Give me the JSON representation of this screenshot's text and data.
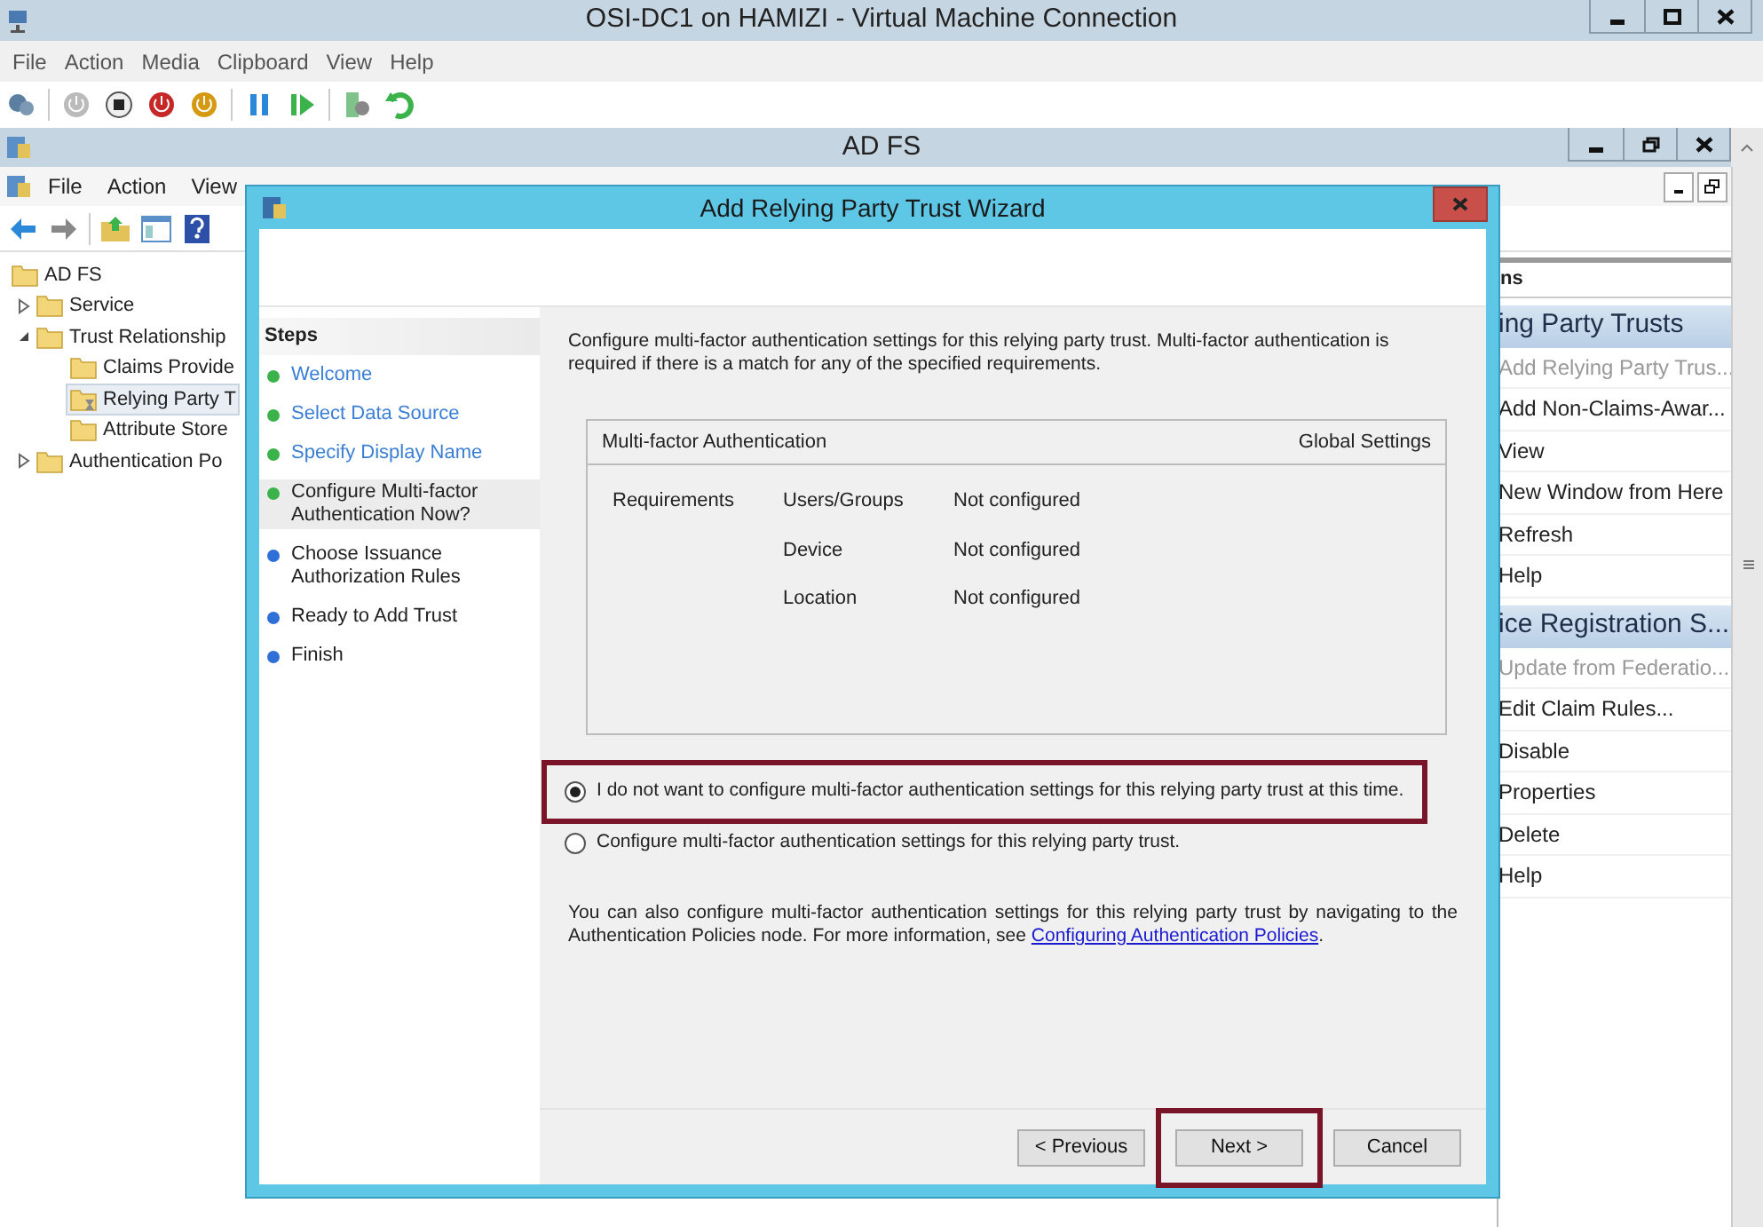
{
  "vm_window": {
    "title": "OSI-DC1 on HAMIZI - Virtual Machine Connection",
    "menu": [
      "File",
      "Action",
      "Media",
      "Clipboard",
      "View",
      "Help"
    ]
  },
  "adfs_window": {
    "title": "AD FS",
    "menu": [
      "File",
      "Action",
      "View"
    ],
    "tree": [
      {
        "label": "AD FS",
        "selected": false,
        "children": [
          {
            "label": "Service",
            "expanded": false,
            "selected": false
          },
          {
            "label": "Trust Relationship",
            "expanded": true,
            "selected": false,
            "children": [
              {
                "label": "Claims Provide",
                "selected": false
              },
              {
                "label": "Relying Party T",
                "selected": true
              },
              {
                "label": "Attribute Store",
                "selected": false
              }
            ]
          },
          {
            "label": "Authentication Po",
            "expanded": false,
            "selected": false
          }
        ]
      }
    ],
    "actions": {
      "header": "ns",
      "groups": [
        {
          "title": "ing Party Trusts",
          "items": [
            {
              "label": "Add Relying Party Trus...",
              "disabled": true
            },
            {
              "label": "Add Non-Claims-Awar...",
              "disabled": false
            },
            {
              "label": "View",
              "disabled": false
            },
            {
              "label": "New Window from Here",
              "disabled": false
            },
            {
              "label": "Refresh",
              "disabled": false
            },
            {
              "label": "Help",
              "disabled": false
            }
          ]
        },
        {
          "title": "ice Registration S...",
          "items": [
            {
              "label": "Update from Federatio...",
              "disabled": true
            },
            {
              "label": "Edit Claim Rules...",
              "disabled": false
            },
            {
              "label": "Disable",
              "disabled": false
            },
            {
              "label": "Properties",
              "disabled": false
            },
            {
              "label": "Delete",
              "disabled": false
            },
            {
              "label": "Help",
              "disabled": false
            }
          ]
        }
      ]
    }
  },
  "wizard": {
    "title": "Add Relying Party Trust Wizard",
    "steps_heading": "Steps",
    "steps": [
      {
        "label": "Welcome",
        "completed": true,
        "selected": false
      },
      {
        "label": "Select Data Source",
        "completed": true,
        "selected": false
      },
      {
        "label": "Specify Display Name",
        "completed": true,
        "selected": false
      },
      {
        "label": "Configure Multi-factor Authentication Now?",
        "completed": true,
        "selected": true
      },
      {
        "label": "Choose Issuance Authorization Rules",
        "completed": false,
        "selected": false
      },
      {
        "label": "Ready to Add Trust",
        "completed": false,
        "selected": false
      },
      {
        "label": "Finish",
        "completed": false,
        "selected": false
      }
    ],
    "description": "Configure multi-factor authentication settings for this relying party trust. Multi-factor authentication is required if there is a match for any of the specified requirements.",
    "mfa_table": {
      "title": "Multi-factor Authentication",
      "global_settings": "Global Settings",
      "requirements_label": "Requirements",
      "rows": [
        {
          "name": "Users/Groups",
          "value": "Not configured"
        },
        {
          "name": "Device",
          "value": "Not configured"
        },
        {
          "name": "Location",
          "value": "Not configured"
        }
      ]
    },
    "options": [
      {
        "label": "I do not want to configure multi-factor authentication settings for this relying party trust at this time.",
        "selected": true,
        "highlighted": true
      },
      {
        "label": "Configure multi-factor authentication settings for this relying party trust.",
        "selected": false,
        "highlighted": false
      }
    ],
    "note": "You can also configure multi-factor authentication settings for this relying party trust by navigating to the Authentication Policies node. For more information, see ",
    "note_link": "Configuring Authentication Policies",
    "note_end": ".",
    "buttons": [
      {
        "label": "< Previous",
        "highlighted": false
      },
      {
        "label": "Next >",
        "highlighted": true
      },
      {
        "label": "Cancel",
        "highlighted": false
      }
    ]
  }
}
